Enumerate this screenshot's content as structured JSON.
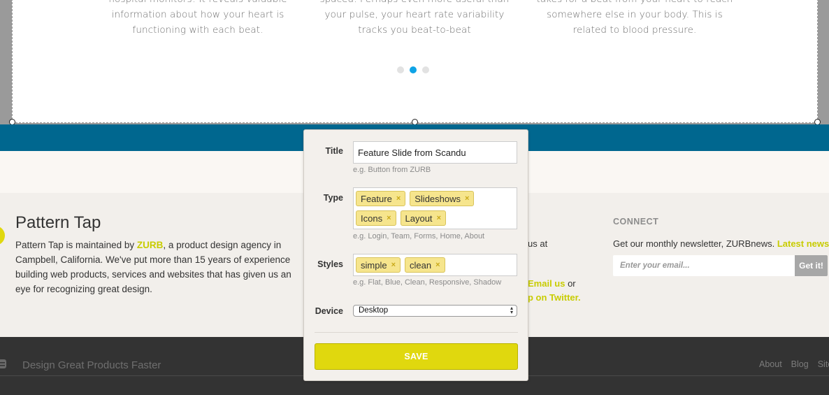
{
  "slideshow": {
    "features": [
      {
        "text": "hospital monitors! It reveals valuable information about how your heart is functioning with each beat."
      },
      {
        "text": "spaced. Perhaps even more useful than your pulse, your heart rate variability tracks you beat-to-beat"
      },
      {
        "text": "takes for a beat from your heart to reach somewhere else in your body. This is related to blood pressure."
      }
    ],
    "pagination": {
      "count": 3,
      "active_index": 1,
      "active_color": "#0ea3e6"
    }
  },
  "about": {
    "title": "Pattern Tap",
    "desc_before": "Pattern Tap is maintained by ",
    "link": "ZURB",
    "desc_after": ", a product design agency in Campbell, California. We've put more than 15 years of experience building web products, services and websites that has given us an eye for recognizing great design."
  },
  "contact": {
    "line1": "us at",
    "email_link": "Email us",
    "or": " or",
    "twitter_link": "p on Twitter."
  },
  "connect": {
    "heading": "CONNECT",
    "desc": "Get our monthly newsletter, ZURBnews. ",
    "desc_link": "Latest news & i",
    "email_placeholder": "Enter your email...",
    "button": "Get it!"
  },
  "footer": {
    "tagline": "Design Great Products Faster",
    "links": [
      "About",
      "Blog",
      "Site"
    ]
  },
  "modal": {
    "title_label": "Title",
    "title_value": "Feature Slide from Scandu",
    "title_hint": "e.g. Button from ZURB",
    "type_label": "Type",
    "type_tags": [
      "Feature",
      "Slideshows",
      "Icons",
      "Layout"
    ],
    "type_hint": "e.g. Login, Team, Forms, Home, About",
    "styles_label": "Styles",
    "style_tags": [
      "simple",
      "clean"
    ],
    "styles_hint": "e.g. Flat, Blue, Clean, Responsive, Shadow",
    "device_label": "Device",
    "device_value": "Desktop",
    "save_label": "SAVE",
    "tag_remove_glyph": "×"
  },
  "colors": {
    "accent_yellow": "#e0d80e",
    "blue_bar": "#00678f",
    "footer_dark": "#333333"
  }
}
